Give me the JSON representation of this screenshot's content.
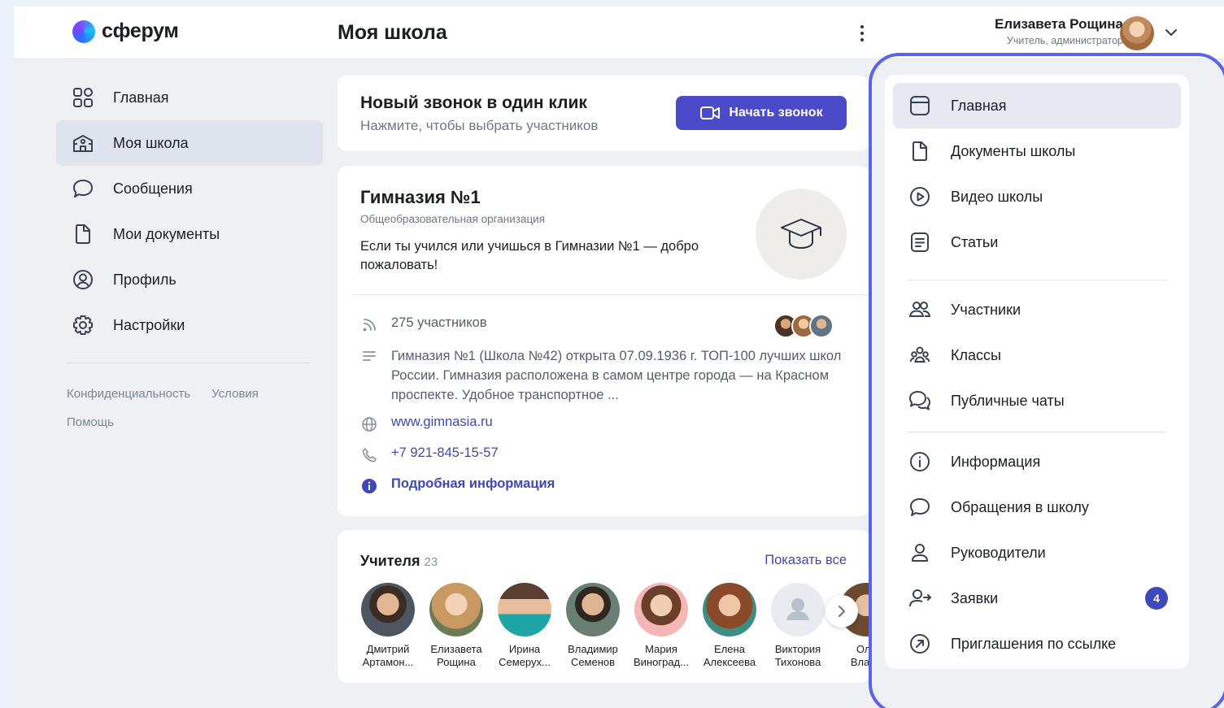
{
  "app": {
    "logo_text": "сферум"
  },
  "header": {
    "title": "Моя школа",
    "user_name": "Елизавета Рощина",
    "user_role": "Учитель, администратор"
  },
  "leftnav": {
    "items": [
      {
        "label": "Главная",
        "icon": "grid-icon"
      },
      {
        "label": "Моя школа",
        "icon": "school-icon"
      },
      {
        "label": "Сообщения",
        "icon": "chat-icon"
      },
      {
        "label": "Мои документы",
        "icon": "document-icon"
      },
      {
        "label": "Профиль",
        "icon": "user-circle-icon"
      },
      {
        "label": "Настройки",
        "icon": "gear-icon"
      }
    ],
    "active_index": 1,
    "links": [
      "Конфиденциальность",
      "Условия",
      "Помощь"
    ]
  },
  "call": {
    "title": "Новый звонок в один клик",
    "subtitle": "Нажмите, чтобы выбрать участников",
    "button": "Начать звонок"
  },
  "school": {
    "name": "Гимназия №1",
    "type": "Общеобразовательная организация",
    "description": "Если ты учился или учишься в Гимназии №1 — добро пожаловать!",
    "members": "275 участников",
    "about": "Гимназия №1 (Школа №42) открыта 07.09.1936 г. ТОП-100 лучших школ России. Гимназия расположена в самом центре города — на Красном проспекте. Удобное транспортное ...",
    "website": "www.gimnasia.ru",
    "phone": "+7 921-845-15-57",
    "more_info": "Подробная информация"
  },
  "teachers": {
    "title": "Учителя",
    "count": "23",
    "show_all": "Показать все",
    "items": [
      {
        "first": "Дмитрий",
        "last": "Артамон..."
      },
      {
        "first": "Елизавета",
        "last": "Рощина"
      },
      {
        "first": "Ирина",
        "last": "Семерух..."
      },
      {
        "first": "Владимир",
        "last": "Семенов"
      },
      {
        "first": "Мария",
        "last": "Виноград..."
      },
      {
        "first": "Елена",
        "last": "Алексеева"
      },
      {
        "first": "Виктория",
        "last": "Тихонова"
      },
      {
        "first": "Оль",
        "last": "Влади"
      }
    ]
  },
  "rightmenu": {
    "items": [
      {
        "label": "Главная",
        "icon": "window-icon"
      },
      {
        "label": "Документы школы",
        "icon": "document-icon"
      },
      {
        "label": "Видео школы",
        "icon": "play-circle-icon"
      },
      {
        "label": "Статьи",
        "icon": "article-icon"
      },
      {
        "label": "Участники",
        "icon": "users-icon"
      },
      {
        "label": "Классы",
        "icon": "group-icon"
      },
      {
        "label": "Публичные чаты",
        "icon": "chats-icon"
      },
      {
        "label": "Информация",
        "icon": "info-icon"
      },
      {
        "label": "Обращения в школу",
        "icon": "message-icon"
      },
      {
        "label": "Руководители",
        "icon": "person-icon"
      },
      {
        "label": "Заявки",
        "icon": "user-add-icon",
        "badge": "4"
      },
      {
        "label": "Приглашения по ссылке",
        "icon": "link-arrow-icon"
      }
    ]
  },
  "colors": {
    "accent": "#4b4ac9",
    "link": "#3f48b8",
    "highlight_ring": "#5b63ea"
  }
}
